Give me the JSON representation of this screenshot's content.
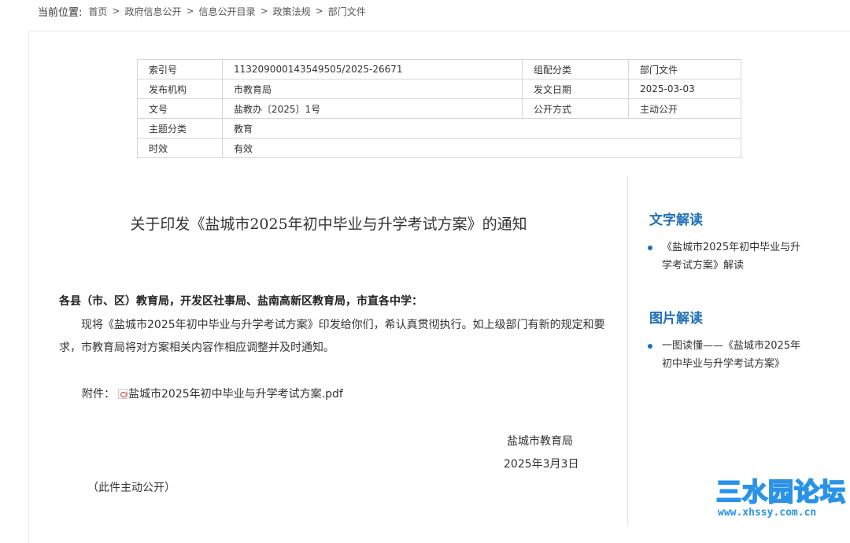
{
  "breadcrumb": {
    "label": "当前位置:",
    "items": [
      "首页",
      "政府信息公开",
      "信息公开目录",
      "政策法规",
      "部门文件"
    ],
    "separator": ">"
  },
  "meta": {
    "rows": [
      {
        "l1": "索引号",
        "v1": "113209000143549505/2025-26671",
        "l2": "组配分类",
        "v2": "部门文件"
      },
      {
        "l1": "发布机构",
        "v1": "市教育局",
        "l2": "发文日期",
        "v2": "2025-03-03"
      },
      {
        "l1": "文号",
        "v1": "盐教办〔2025〕1号",
        "l2": "公开方式",
        "v2": "主动公开"
      },
      {
        "l1": "主题分类",
        "v1": "教育"
      },
      {
        "l1": "时效",
        "v1": "有效"
      }
    ]
  },
  "document": {
    "title": "关于印发《盐城市2025年初中毕业与升学考试方案》的通知",
    "salutation": "各县（市、区）教育局，开发区社事局、盐南高新区教育局，市直各中学：",
    "body": "现将《盐城市2025年初中毕业与升学考试方案》印发给你们，希认真贯彻执行。如上级部门有新的规定和要求，市教育局将对方案相关内容作相应调整并及时通知。",
    "attachment_label": "附件：",
    "attachment_file": "盐城市2025年初中毕业与升学考试方案.pdf",
    "sign_org": "盐城市教育局",
    "sign_date": "2025年3月3日",
    "public_note": "（此件主动公开）"
  },
  "sidebar": {
    "text_heading": "文字解读",
    "text_link": "《盐城市2025年初中毕业与升学考试方案》解读",
    "image_heading": "图片解读",
    "image_link": "一图读懂——《盐城市2025年初中毕业与升学考试方案》"
  },
  "watermark": {
    "logo": "三水园论坛",
    "url": "www.xhssy.com.cn"
  },
  "colors": {
    "accent": "#1f6fb6",
    "watermark": "#2a93e8",
    "border": "#d6d6d6"
  },
  "icons": {
    "attachment": "pdf-icon",
    "list_bullet": "bullet-dot-icon"
  }
}
